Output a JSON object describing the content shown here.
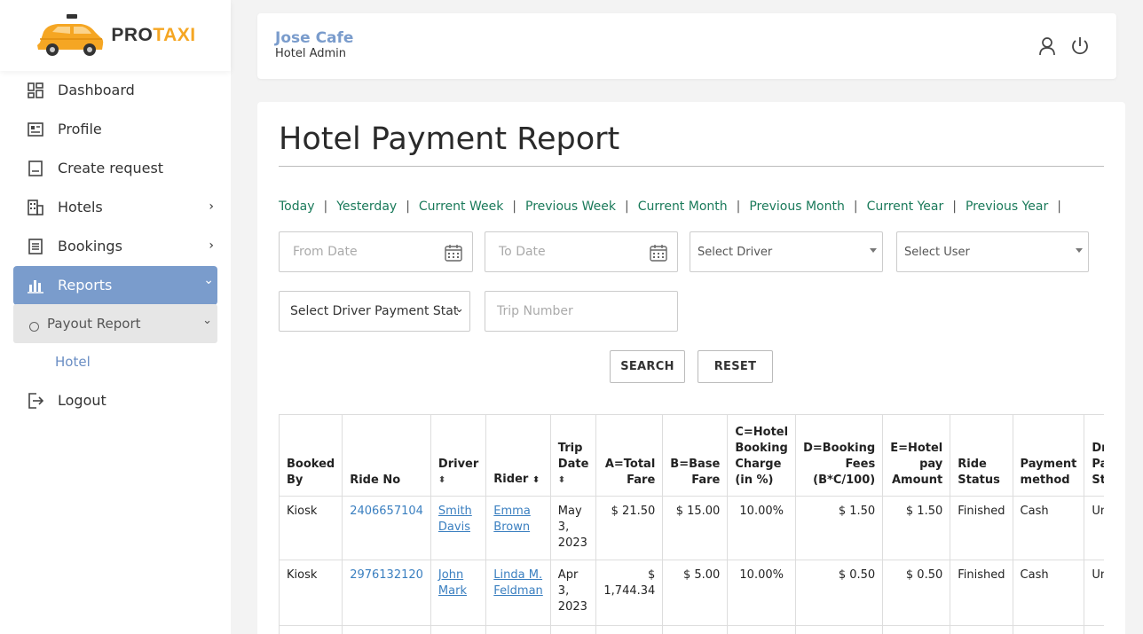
{
  "brand": {
    "pro": "PRO",
    "taxi": "TAXI"
  },
  "sidebar": {
    "items": [
      {
        "label": "Dashboard"
      },
      {
        "label": "Profile"
      },
      {
        "label": "Create request"
      },
      {
        "label": "Hotels",
        "chevron": "›"
      },
      {
        "label": "Bookings",
        "chevron": "›"
      },
      {
        "label": "Reports",
        "chevron": "⌄"
      }
    ],
    "submenu": {
      "label": "Payout Report",
      "chevron": "⌄",
      "child": "Hotel"
    },
    "logout": "Logout"
  },
  "header": {
    "name": "Jose Cafe",
    "role": "Hotel Admin"
  },
  "page": {
    "title": "Hotel Payment Report"
  },
  "quick_filters": [
    "Today",
    "Yesterday",
    "Current Week",
    "Previous Week",
    "Current Month",
    "Previous Month",
    "Current Year",
    "Previous Year"
  ],
  "quick_sep": "|",
  "filters": {
    "from_date": "From Date",
    "to_date": "To Date",
    "driver": "Select Driver",
    "user": "Select User",
    "payment_status": "Select Driver Payment Stat",
    "trip_number": "Trip Number"
  },
  "buttons": {
    "search": "SEARCH",
    "reset": "RESET"
  },
  "table": {
    "headers": {
      "booked_by": "Booked By",
      "ride_no": "Ride No",
      "driver": "Driver",
      "rider": "Rider",
      "trip_date": "Trip Date",
      "total_fare": "A=Total Fare",
      "base_fare": "B=Base Fare",
      "hotel_charge": "C=Hotel Booking Charge (in %)",
      "booking_fees": "D=Booking Fees (B*C/100)",
      "hotel_pay": "E=Hotel pay Amount",
      "ride_status": "Ride Status",
      "payment_method": "Payment method",
      "driver_payment_status": "Driver Payment Status"
    },
    "sort_icon": "⬍",
    "rows": [
      {
        "booked_by": "Kiosk",
        "ride_no": "2406657104",
        "driver": "Smith Davis",
        "rider": "Emma Brown",
        "trip_date": "May 3, 2023",
        "total_fare": "$ 21.50",
        "base_fare": "$ 15.00",
        "hotel_charge": "10.00%",
        "booking_fees": "$ 1.50",
        "hotel_pay": "$ 1.50",
        "ride_status": "Finished",
        "payment_method": "Cash",
        "driver_payment_status": "Unsettled"
      },
      {
        "booked_by": "Kiosk",
        "ride_no": "2976132120",
        "driver": "John Mark",
        "rider": "Linda M. Feldman",
        "trip_date": "Apr 3, 2023",
        "total_fare": "$ 1,744.34",
        "base_fare": "$ 5.00",
        "hotel_charge": "10.00%",
        "booking_fees": "$ 0.50",
        "hotel_pay": "$ 0.50",
        "ride_status": "Finished",
        "payment_method": "Cash",
        "driver_payment_status": "Unsettled"
      }
    ]
  },
  "colors": {
    "accent": "#7a9ccc",
    "brand": "#f5a623",
    "link_green": "#1a7a5a",
    "link_blue": "#3a7fc0"
  }
}
